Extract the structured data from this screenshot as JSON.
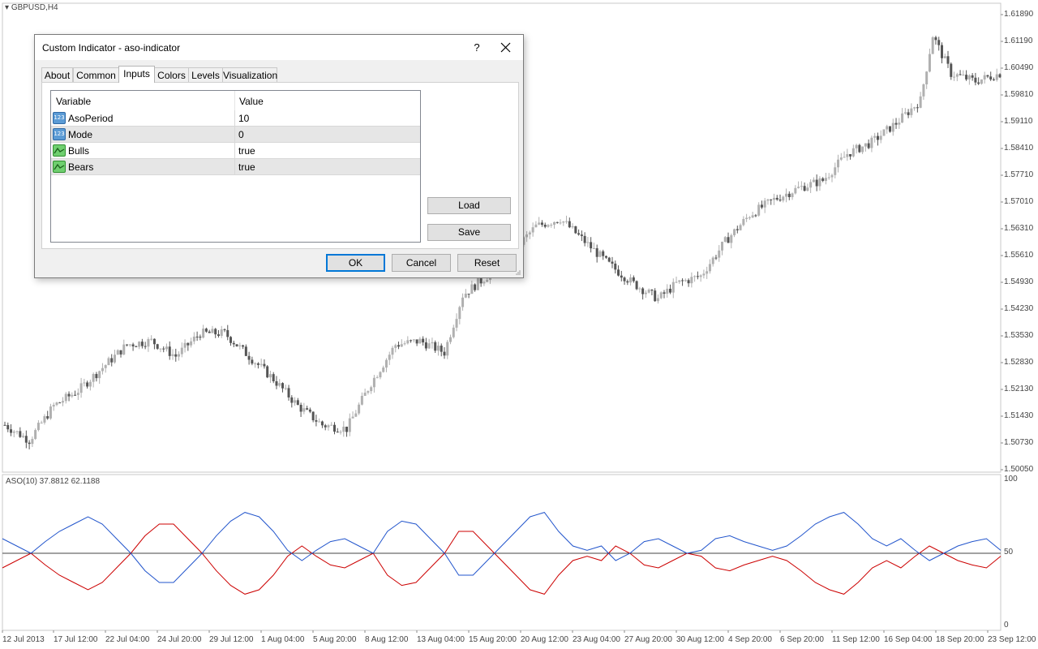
{
  "chart": {
    "symbol_label": "GBPUSD,H4",
    "price_ticks": [
      "1.61890",
      "1.61190",
      "1.60490",
      "1.59810",
      "1.59110",
      "1.58410",
      "1.57710",
      "1.57010",
      "1.56310",
      "1.55610",
      "1.54930",
      "1.54230",
      "1.53530",
      "1.52830",
      "1.52130",
      "1.51430",
      "1.50730",
      "1.50050"
    ],
    "date_ticks": [
      "12 Jul 2013",
      "17 Jul 12:00",
      "22 Jul 04:00",
      "24 Jul 20:00",
      "29 Jul 12:00",
      "1 Aug 04:00",
      "5 Aug 20:00",
      "8 Aug 12:00",
      "13 Aug 04:00",
      "15 Aug 20:00",
      "20 Aug 12:00",
      "23 Aug 04:00",
      "27 Aug 20:00",
      "30 Aug 12:00",
      "4 Sep 20:00",
      "6 Sep 20:00",
      "11 Sep 12:00",
      "16 Sep 04:00",
      "18 Sep 20:00",
      "23 Sep 12:00"
    ],
    "indicator_label": "ASO(10) 37.8812 62.1188",
    "osc_ticks": [
      "100",
      "50",
      "0"
    ],
    "colors": {
      "bulls": "#cc0000",
      "bears": "#2255cc",
      "up_candle": "#b0b0b0",
      "down_candle": "#555555"
    }
  },
  "chart_data": [
    {
      "type": "candlestick",
      "title": "GBPUSD,H4",
      "xlabel": "",
      "ylabel": "",
      "ylim": [
        1.5005,
        1.6224
      ],
      "close_trend": [
        [
          0,
          1.512
        ],
        [
          8,
          1.508
        ],
        [
          16,
          1.517
        ],
        [
          24,
          1.521
        ],
        [
          32,
          1.527
        ],
        [
          40,
          1.533
        ],
        [
          48,
          1.534
        ],
        [
          56,
          1.53
        ],
        [
          64,
          1.536
        ],
        [
          72,
          1.536
        ],
        [
          80,
          1.53
        ],
        [
          88,
          1.524
        ],
        [
          96,
          1.517
        ],
        [
          104,
          1.512
        ],
        [
          112,
          1.511
        ],
        [
          120,
          1.523
        ],
        [
          128,
          1.533
        ],
        [
          136,
          1.534
        ],
        [
          144,
          1.531
        ],
        [
          150,
          1.546
        ],
        [
          158,
          1.551
        ],
        [
          166,
          1.557
        ],
        [
          174,
          1.564
        ],
        [
          182,
          1.566
        ],
        [
          190,
          1.56
        ],
        [
          198,
          1.554
        ],
        [
          206,
          1.549
        ],
        [
          214,
          1.545
        ],
        [
          220,
          1.549
        ],
        [
          228,
          1.551
        ],
        [
          236,
          1.56
        ],
        [
          244,
          1.567
        ],
        [
          252,
          1.571
        ],
        [
          260,
          1.574
        ],
        [
          268,
          1.576
        ],
        [
          276,
          1.583
        ],
        [
          284,
          1.586
        ],
        [
          292,
          1.591
        ],
        [
          300,
          1.597
        ],
        [
          304,
          1.614
        ],
        [
          310,
          1.604
        ],
        [
          318,
          1.602
        ],
        [
          326,
          1.604
        ]
      ]
    },
    {
      "type": "line",
      "title": "ASO(10) 37.8812 62.1188",
      "ylim": [
        0,
        100
      ],
      "series": [
        {
          "values": [
            40,
            45,
            50,
            42,
            35,
            30,
            25,
            30,
            40,
            50,
            62,
            70,
            70,
            60,
            50,
            38,
            28,
            22,
            25,
            35,
            48,
            55,
            48,
            42,
            40,
            45,
            50,
            35,
            28,
            30,
            40,
            50,
            65,
            65,
            55,
            45,
            35,
            25,
            22,
            35,
            45,
            48,
            45,
            55,
            50,
            42,
            40,
            45,
            50,
            48,
            40,
            38,
            42,
            45,
            48,
            45,
            38,
            30,
            25,
            22,
            30,
            40,
            45,
            40,
            48,
            55,
            50,
            45,
            42,
            40,
            48
          ]
        },
        {
          "values": [
            60,
            55,
            50,
            58,
            65,
            70,
            75,
            70,
            60,
            50,
            38,
            30,
            30,
            40,
            50,
            62,
            72,
            78,
            75,
            65,
            52,
            45,
            52,
            58,
            60,
            55,
            50,
            65,
            72,
            70,
            60,
            50,
            35,
            35,
            45,
            55,
            65,
            75,
            78,
            65,
            55,
            52,
            55,
            45,
            50,
            58,
            60,
            55,
            50,
            52,
            60,
            62,
            58,
            55,
            52,
            55,
            62,
            70,
            75,
            78,
            70,
            60,
            55,
            60,
            52,
            45,
            50,
            55,
            58,
            60,
            52
          ]
        }
      ]
    }
  ],
  "dialog": {
    "title": "Custom Indicator - aso-indicator",
    "help_label": "?",
    "tabs": [
      {
        "label": "About"
      },
      {
        "label": "Common"
      },
      {
        "label": "Inputs"
      },
      {
        "label": "Colors"
      },
      {
        "label": "Levels"
      },
      {
        "label": "Visualization"
      }
    ],
    "grid": {
      "col_variable": "Variable",
      "col_value": "Value",
      "rows": [
        {
          "name": "AsoPeriod",
          "value": "10",
          "icon": "int-123-icon"
        },
        {
          "name": "Mode",
          "value": "0",
          "icon": "int-123-icon"
        },
        {
          "name": "Bulls",
          "value": "true",
          "icon": "bool-chart-icon"
        },
        {
          "name": "Bears",
          "value": "true",
          "icon": "bool-chart-icon"
        }
      ]
    },
    "load_label": "Load",
    "save_label": "Save",
    "ok_label": "OK",
    "cancel_label": "Cancel",
    "reset_label": "Reset"
  }
}
